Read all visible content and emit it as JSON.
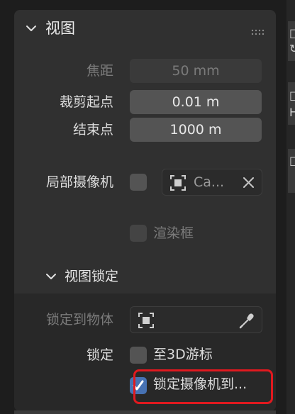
{
  "panel": {
    "title": "视图"
  },
  "lens": {
    "focal_label": "焦距",
    "focal_value": "50 mm",
    "clip_start_label": "裁剪起点",
    "clip_start_value": "0.01 m",
    "clip_end_label": "结束点",
    "clip_end_value": "1000 m"
  },
  "local_camera": {
    "label": "局部摄像机",
    "enabled": false,
    "camera_name": "Ca..."
  },
  "render_border": {
    "label": "渲染框",
    "enabled": false
  },
  "view_lock": {
    "title": "视图锁定",
    "lock_object_label": "锁定到物体",
    "lock_label": "锁定",
    "to_3d_cursor_label": "至3D游标",
    "to_3d_cursor_checked": false,
    "camera_to_view_label": "锁定摄像机到...",
    "camera_to_view_checked": true
  },
  "right_strip": {
    "glyphs": [
      "□",
      "↻",
      "□",
      "H",
      "□"
    ]
  },
  "colors": {
    "background": "#1d1d1d",
    "panel": "#303030",
    "field": "#545454",
    "accent": "#4772b3",
    "highlight": "#e0191f"
  }
}
